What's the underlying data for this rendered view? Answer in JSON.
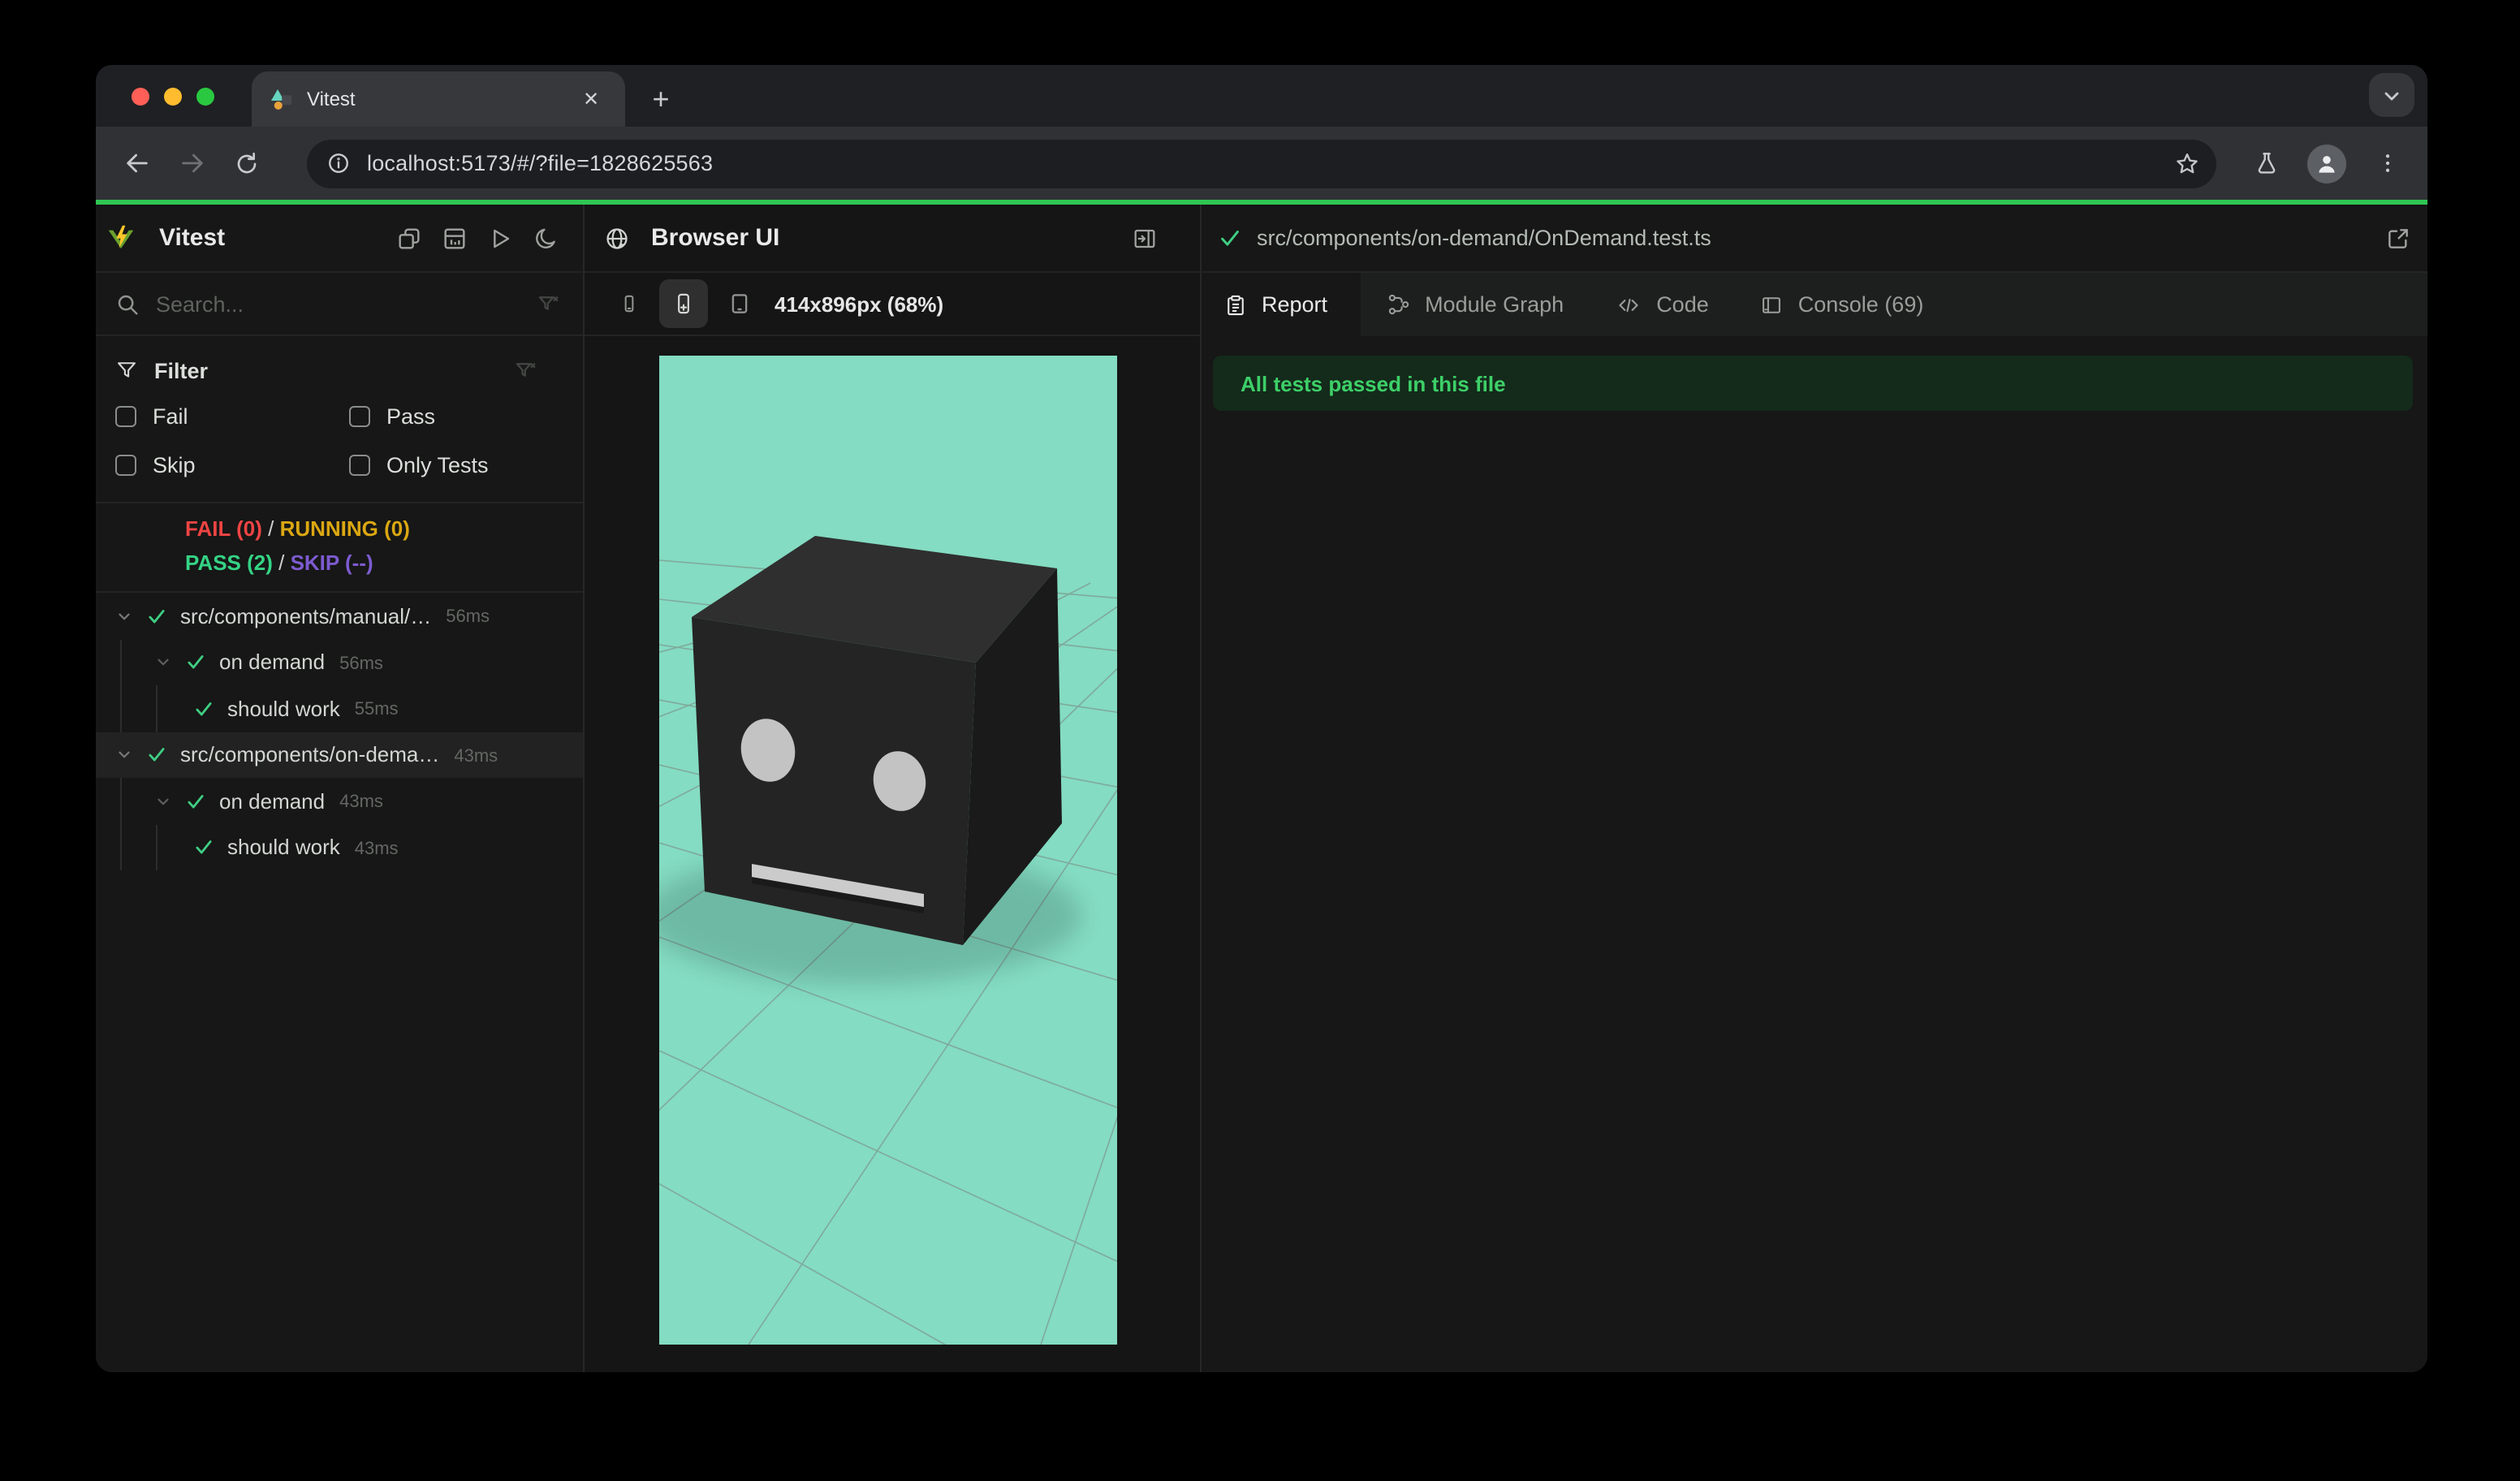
{
  "browser": {
    "tab_title": "Vitest",
    "url": "localhost:5173/#/?file=1828625563",
    "close_glyph": "✕",
    "newtab_glyph": "+"
  },
  "colors": {
    "accent_green": "#3fce83",
    "fail_red": "#ef4444",
    "running_yellow": "#dba712",
    "skip_purple": "#7d5bd0",
    "progress_green": "#2fc653",
    "viewport_teal": "#84dcc2"
  },
  "sidebar": {
    "app_name": "Vitest",
    "search_placeholder": "Search...",
    "filter": {
      "title": "Filter",
      "fail": "Fail",
      "pass": "Pass",
      "skip": "Skip",
      "only": "Only Tests"
    },
    "summary": {
      "fail": "FAIL (0)",
      "running": "RUNNING (0)",
      "pass": "PASS (2)",
      "skip": "SKIP (--)",
      "sep1": " / ",
      "sep2": " / "
    },
    "tree": [
      {
        "label": "src/components/manual/…",
        "time": "56ms"
      },
      {
        "label": "on demand",
        "time": "56ms"
      },
      {
        "label": "should work",
        "time": "55ms"
      },
      {
        "label": "src/components/on-dema…",
        "time": "43ms"
      },
      {
        "label": "on demand",
        "time": "43ms"
      },
      {
        "label": "should work",
        "time": "43ms"
      }
    ]
  },
  "browser_panel": {
    "title": "Browser UI",
    "resolution": "414x896px (68%)"
  },
  "report_panel": {
    "file_path": "src/components/on-demand/OnDemand.test.ts",
    "tabs": [
      {
        "label": "Report"
      },
      {
        "label": "Module Graph"
      },
      {
        "label": "Code"
      },
      {
        "label": "Console (69)"
      }
    ],
    "banner": "All tests passed in this file"
  }
}
